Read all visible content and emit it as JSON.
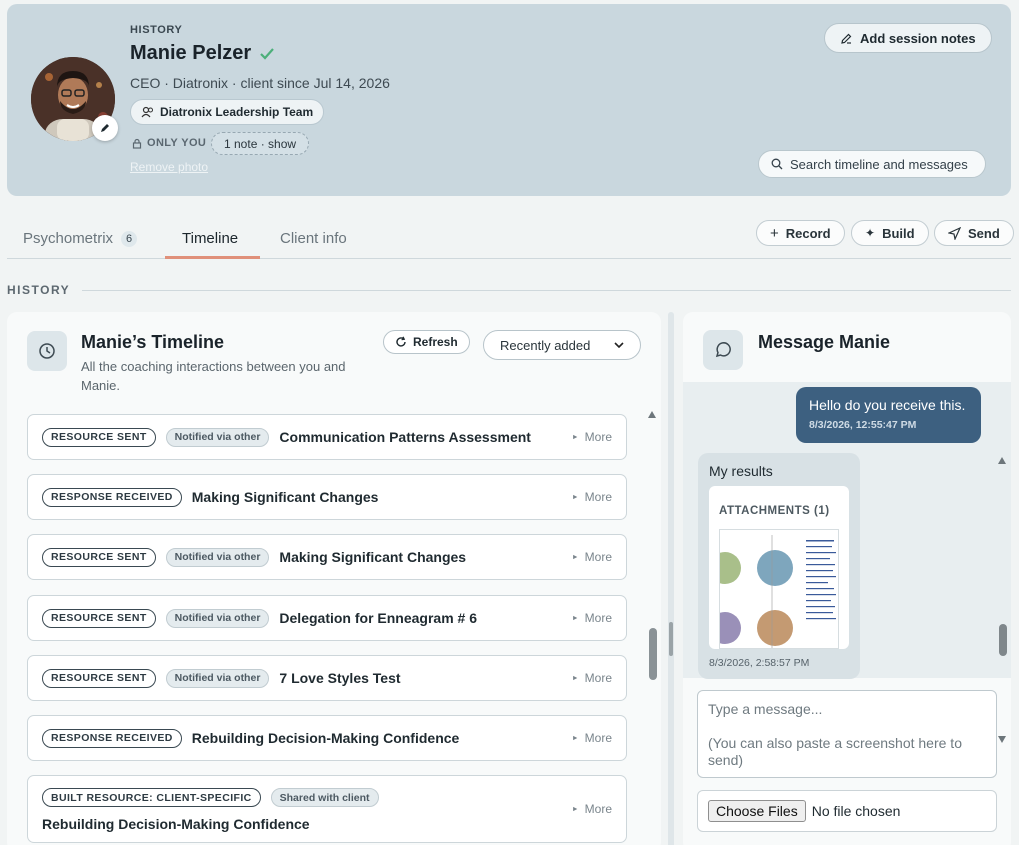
{
  "header": {
    "section_label": "HISTORY",
    "client_name": "Manie Pelzer",
    "subtitle": "CEO · Diatronix · client since Jul 14, 2026",
    "team_label": "Diatronix Leadership Team",
    "only_you_label": "ONLY YOU",
    "note_pill": "1 note · show",
    "remove_photo": "Remove photo",
    "add_notes_label": "Add session notes",
    "search_placeholder": "Search timeline and messages"
  },
  "tabs": [
    {
      "label": "Psychometrix",
      "count": "6"
    },
    {
      "label": "Timeline",
      "active": true
    },
    {
      "label": "Client info"
    }
  ],
  "actions": {
    "record": "Record",
    "build": "Build",
    "send": "Send"
  },
  "history_label": "HISTORY",
  "timeline": {
    "title": "Manie’s Timeline",
    "description": "All the coaching interactions between you and Manie.",
    "refresh_label": "Refresh",
    "sort_value": "Recently added",
    "more_label": "More",
    "items": [
      {
        "badge": "RESOURCE SENT",
        "notif": "Notified via other",
        "title": "Communication Patterns Assessment"
      },
      {
        "badge": "RESPONSE RECEIVED",
        "title": "Making Significant Changes"
      },
      {
        "badge": "RESOURCE SENT",
        "notif": "Notified via other",
        "title": "Making Significant Changes"
      },
      {
        "badge": "RESOURCE SENT",
        "notif": "Notified via other",
        "title": "Delegation for Enneagram # 6"
      },
      {
        "badge": "RESOURCE SENT",
        "notif": "Notified via other",
        "title": "7 Love Styles Test"
      },
      {
        "badge": "RESPONSE RECEIVED",
        "title": "Rebuilding Decision-Making Confidence"
      },
      {
        "badge": "BUILT RESOURCE: CLIENT-SPECIFIC",
        "notif": "Shared with client",
        "title": "Rebuilding Decision-Making Confidence"
      }
    ]
  },
  "messages": {
    "title": "Message Manie",
    "outgoing": {
      "text": "Hello do you receive this.",
      "time": "8/3/2026, 12:55:47 PM"
    },
    "incoming": {
      "text": "My results",
      "attachments_label": "ATTACHMENTS (1)",
      "time": "8/3/2026, 2:58:57 PM"
    },
    "input_placeholder": "Type a message...\n\n(You can also paste a screenshot here to send)",
    "file_button": "Choose Files",
    "file_status": "No file chosen"
  },
  "colors": {
    "accent_tab": "#e0907a",
    "outgoing_bubble": "#3d6080",
    "header_bg": "#c9d7de",
    "check": "#4caf7a"
  }
}
